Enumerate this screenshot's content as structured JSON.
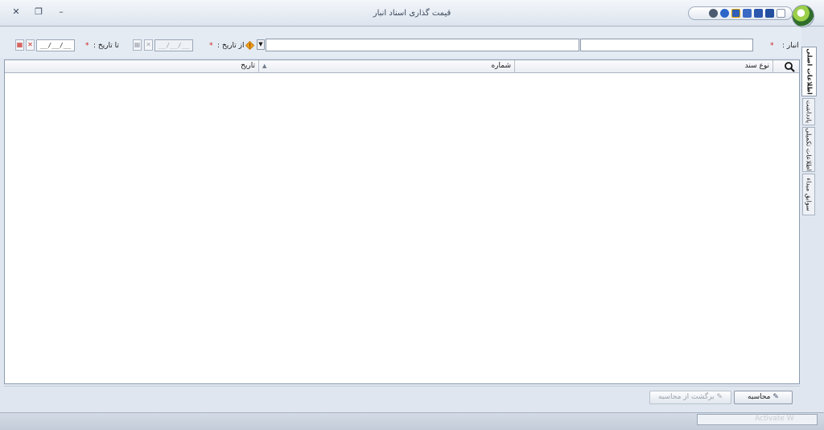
{
  "window": {
    "title": "قیمت گذاری اسناد انبار",
    "controls": {
      "close": "✕",
      "restore": "❐",
      "minimize": "–"
    },
    "quick_access_icons": [
      "new-document-icon",
      "save-icon",
      "save-as-icon",
      "save-close-icon",
      "print-icon",
      "help-icon",
      "info-icon"
    ]
  },
  "filters": {
    "warehouse": {
      "label": "انبار :",
      "required_mark": "*"
    },
    "from_date": {
      "label": "از تاریخ :",
      "required_mark": "*",
      "value": "__/__/__"
    },
    "to_date": {
      "label": "تا تاریخ :",
      "required_mark": "*",
      "value": "__/__/__"
    }
  },
  "grid": {
    "columns": [
      {
        "label": "نوع سند"
      },
      {
        "label": "شماره",
        "sort": "▲"
      },
      {
        "label": "تاریخ"
      }
    ],
    "rows": []
  },
  "buttons": {
    "calculate": "محاسبه",
    "revert": "برگشت از محاسبه"
  },
  "side_tabs": [
    {
      "label": "اطلاعات اصلی",
      "active": true
    },
    {
      "label": "یادداشت",
      "active": false
    },
    {
      "label": "اطلاعات تکمیلی",
      "active": false
    },
    {
      "label": "سوابق مبداء",
      "active": false
    }
  ],
  "status": {
    "watermark": "Activate W"
  },
  "colors": {
    "required": "#d21a1a",
    "window_bg": "#dfe6ef",
    "grid_border": "#8d9cb0"
  }
}
